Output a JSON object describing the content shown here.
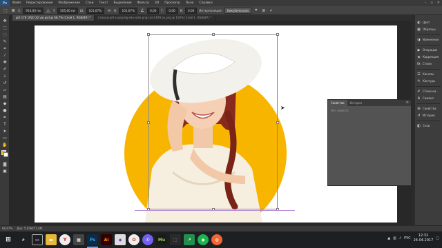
{
  "menu": {
    "app_logo": "Ps",
    "items": [
      "Файл",
      "Редактирование",
      "Изображение",
      "Слои",
      "Текст",
      "Выделение",
      "Фильтр",
      "3D",
      "Просмотр",
      "Окно",
      "Справка"
    ]
  },
  "options_bar": {
    "x_value": "910,00 пи",
    "y_value": "505,00 пи",
    "w_value": "101,67%",
    "h_value": "101,67%",
    "angle_value": "0,00",
    "h_skew": "0,00",
    "v_skew": "0,00",
    "interpolation_label": "Интерполяция:",
    "interpolation_value": "Бикубическая"
  },
  "tabs": [
    {
      "label": "girl 178 1920 32 val.psd @ 66,7% (Слой 1, RGB/8#) *",
      "active": true
    },
    {
      "label": "kisspng-girl-s-png-big-eko-odin-png-cut-t-878 as.png @ 100% (Слой 1, RGB/8#) *",
      "active": false
    }
  ],
  "properties_panel": {
    "tab_properties": "Свойства",
    "tab_history": "История",
    "empty_text": "Нет свойств"
  },
  "dock": {
    "items": [
      {
        "icon": "color-icon",
        "label": "Цвет"
      },
      {
        "icon": "swatches-icon",
        "label": "Образцы"
      },
      {
        "icon": "adjust-icon",
        "label": "Изменения"
      },
      {
        "icon": "play-icon",
        "label": "Операции"
      },
      {
        "icon": "correct-icon",
        "label": "Коррекция"
      },
      {
        "icon": "styles-icon",
        "label": "Стили"
      },
      {
        "icon": "channels-icon",
        "label": "Каналы"
      },
      {
        "icon": "paths-icon",
        "label": "Контуры"
      },
      {
        "icon": "brushes-icon",
        "label": "Стили ки..."
      },
      {
        "icon": "font-icon",
        "label": "Символ"
      },
      {
        "icon": "properties-icon",
        "label": "Свойства"
      },
      {
        "icon": "history-icon",
        "label": "История"
      },
      {
        "icon": "layers-icon",
        "label": "Слои"
      }
    ]
  },
  "status_bar": {
    "zoom": "66,67%",
    "doc_info": "Док: 5,93М/17,4М"
  },
  "taskbar": {
    "lang": "РУС",
    "time": "12:32",
    "date": "24.04.2017"
  },
  "colors": {
    "foreground": "#f2b400",
    "background": "#ffffff",
    "circle": "#f7b500"
  }
}
